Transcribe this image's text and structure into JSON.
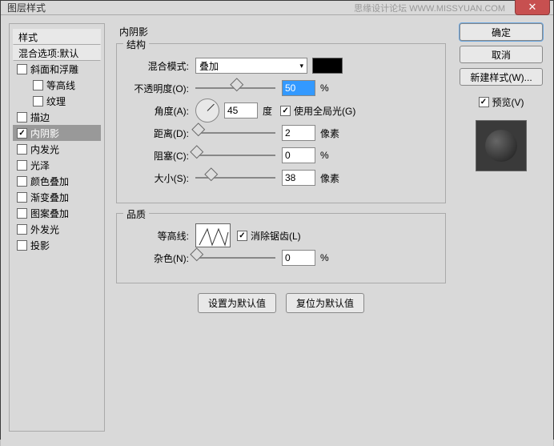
{
  "window": {
    "title": "图层样式",
    "watermark": "思缘设计论坛 WWW.MISSYUAN.COM"
  },
  "left": {
    "header": "样式",
    "blending": "混合选项:默认",
    "items": [
      {
        "label": "斜面和浮雕",
        "checked": false,
        "indent": 0
      },
      {
        "label": "等高线",
        "checked": false,
        "indent": 1
      },
      {
        "label": "纹理",
        "checked": false,
        "indent": 1
      },
      {
        "label": "描边",
        "checked": false,
        "indent": 0
      },
      {
        "label": "内阴影",
        "checked": true,
        "indent": 0,
        "selected": true
      },
      {
        "label": "内发光",
        "checked": false,
        "indent": 0
      },
      {
        "label": "光泽",
        "checked": false,
        "indent": 0
      },
      {
        "label": "颜色叠加",
        "checked": false,
        "indent": 0
      },
      {
        "label": "渐变叠加",
        "checked": false,
        "indent": 0
      },
      {
        "label": "图案叠加",
        "checked": false,
        "indent": 0
      },
      {
        "label": "外发光",
        "checked": false,
        "indent": 0
      },
      {
        "label": "投影",
        "checked": false,
        "indent": 0
      }
    ]
  },
  "center": {
    "title": "内阴影",
    "struct_title": "结构",
    "blend_mode": {
      "label": "混合模式:",
      "value": "叠加"
    },
    "opacity": {
      "label": "不透明度(O):",
      "value": "50",
      "unit": "%",
      "pos": 50
    },
    "angle": {
      "label": "角度(A):",
      "value": "45",
      "unit": "度"
    },
    "global": {
      "label": "使用全局光(G)",
      "checked": true
    },
    "distance": {
      "label": "距离(D):",
      "value": "2",
      "unit": "像素",
      "pos": 2
    },
    "choke": {
      "label": "阻塞(C):",
      "value": "0",
      "unit": "%",
      "pos": 0
    },
    "size": {
      "label": "大小(S):",
      "value": "38",
      "unit": "像素",
      "pos": 18
    },
    "quality_title": "品质",
    "contour": {
      "label": "等高线:"
    },
    "antialias": {
      "label": "消除锯齿(L)",
      "checked": true
    },
    "noise": {
      "label": "杂色(N):",
      "value": "0",
      "unit": "%",
      "pos": 0
    },
    "btn_default": "设置为默认值",
    "btn_reset": "复位为默认值"
  },
  "right": {
    "ok": "确定",
    "cancel": "取消",
    "new_style": "新建样式(W)...",
    "preview": {
      "label": "预览(V)",
      "checked": true
    }
  }
}
